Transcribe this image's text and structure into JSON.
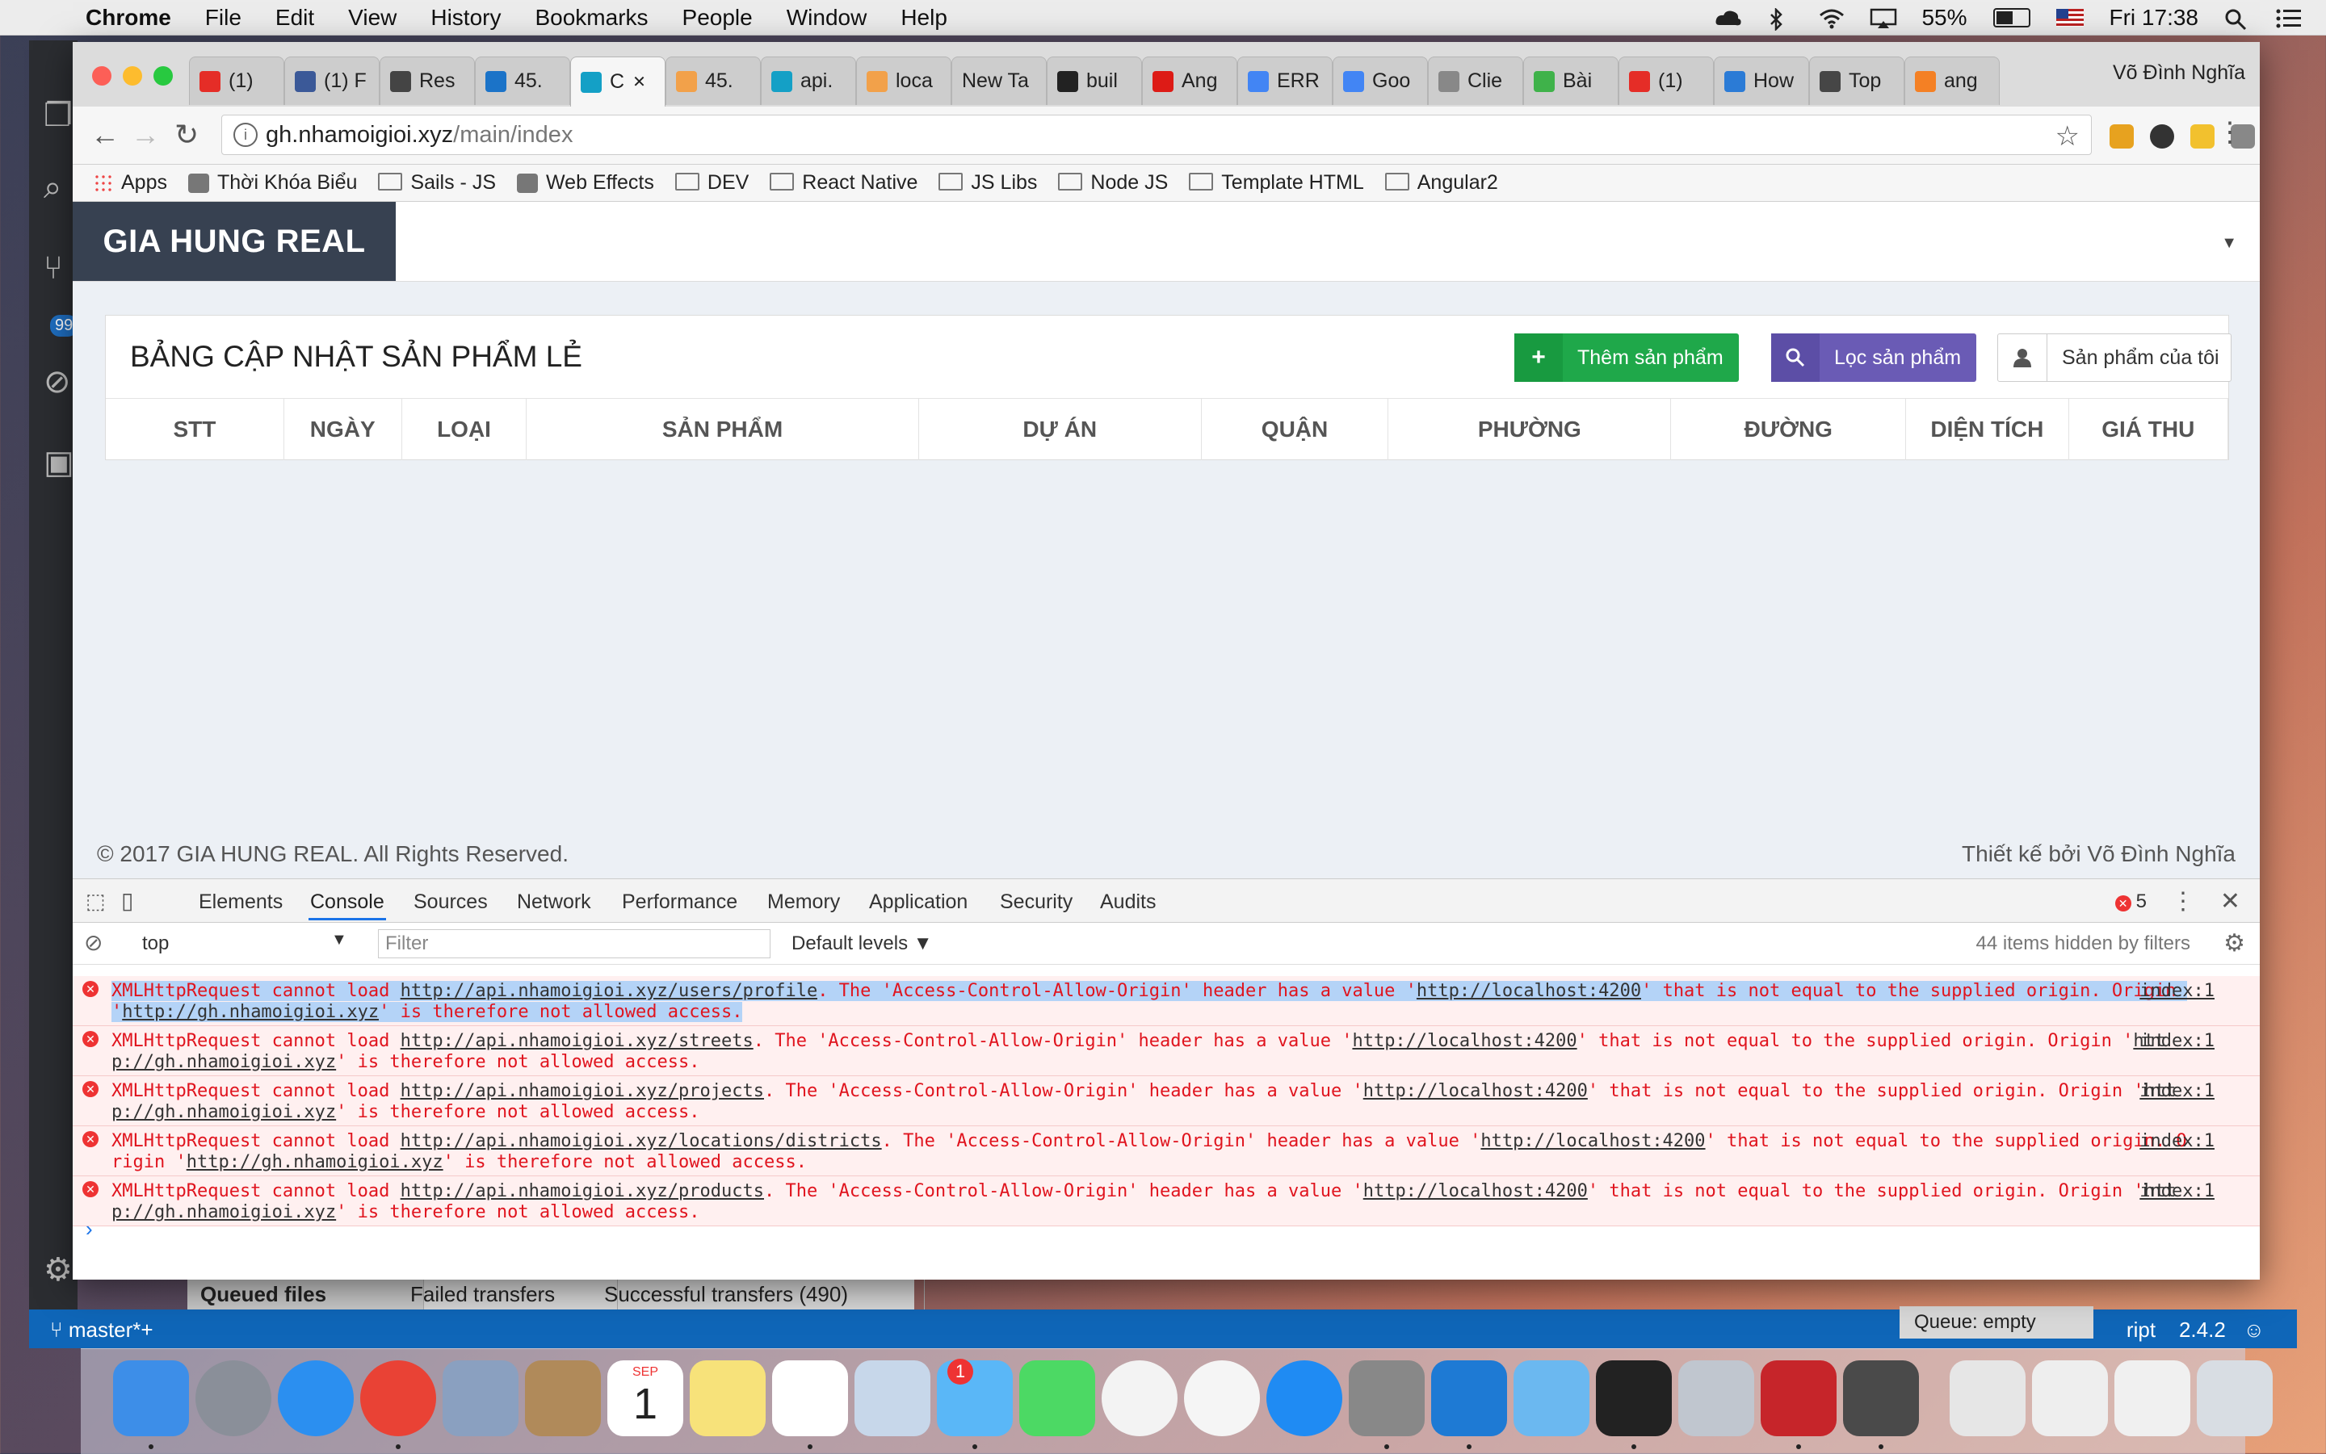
{
  "menubar": {
    "app": "Chrome",
    "items": [
      "File",
      "Edit",
      "View",
      "History",
      "Bookmarks",
      "People",
      "Window",
      "Help"
    ],
    "battery": "55%",
    "clock": "Fri 17:38"
  },
  "browser": {
    "profile_name": "Võ Đình Nghĩa",
    "tabs": [
      {
        "label": "(1)",
        "icon": "youtube-icon",
        "color": "#e52d27"
      },
      {
        "label": "(1) F",
        "icon": "facebook-icon",
        "color": "#3b5998"
      },
      {
        "label": "Res",
        "icon": "resource-icon",
        "color": "#444444"
      },
      {
        "label": "45.",
        "icon": "globe-icon",
        "color": "#1b73c8"
      },
      {
        "label": "C",
        "icon": "sails-icon",
        "color": "#14a0c6",
        "active": true
      },
      {
        "label": "45.",
        "icon": "phpmyadmin-icon",
        "color": "#f2a14a"
      },
      {
        "label": "api.",
        "icon": "sails-icon",
        "color": "#14a0c6"
      },
      {
        "label": "loca",
        "icon": "phpmyadmin-icon",
        "color": "#f2a14a"
      },
      {
        "label": "New Ta",
        "icon": "",
        "color": ""
      },
      {
        "label": "buil",
        "icon": "github-icon",
        "color": "#222222"
      },
      {
        "label": "Ang",
        "icon": "angular-icon",
        "color": "#dd1b16"
      },
      {
        "label": "ERR",
        "icon": "google-icon",
        "color": "#4285f4"
      },
      {
        "label": "Goo",
        "icon": "google-translate-icon",
        "color": "#4285f4"
      },
      {
        "label": "Clie",
        "icon": "document-icon",
        "color": "#888888"
      },
      {
        "label": "Bài",
        "icon": "site-icon",
        "color": "#3fb24a"
      },
      {
        "label": "(1)",
        "icon": "youtube-icon",
        "color": "#e52d27"
      },
      {
        "label": "How",
        "icon": "code-icon",
        "color": "#2b7bd6"
      },
      {
        "label": "Top",
        "icon": "wordpress-icon",
        "color": "#464646"
      },
      {
        "label": "ang",
        "icon": "stackoverflow-icon",
        "color": "#f48024"
      }
    ],
    "url_host": "gh.nhamoigioi.xyz",
    "url_path": "/main/index",
    "bookmarks": [
      {
        "label": "Apps",
        "type": "apps"
      },
      {
        "label": "Thời Khóa Biểu",
        "type": "site"
      },
      {
        "label": "Sails - JS",
        "type": "folder"
      },
      {
        "label": "Web Effects",
        "type": "site"
      },
      {
        "label": "DEV",
        "type": "folder"
      },
      {
        "label": "React Native",
        "type": "folder"
      },
      {
        "label": "JS Libs",
        "type": "folder"
      },
      {
        "label": "Node JS",
        "type": "folder"
      },
      {
        "label": "Template HTML",
        "type": "folder"
      },
      {
        "label": "Angular2",
        "type": "folder"
      }
    ]
  },
  "page": {
    "brand": "GIA HUNG REAL",
    "box_title": "BẢNG CẬP NHẬT SẢN PHẨM LẺ",
    "btn_add": "Thêm sản phẩm",
    "btn_filter": "Lọc sản phẩm",
    "btn_mine": "Sản phẩm của tôi",
    "columns": [
      "STT",
      "NGÀY",
      "LOẠI",
      "SẢN PHẨM",
      "DỰ ÁN",
      "QUẬN",
      "PHƯỜNG",
      "ĐƯỜNG",
      "DIỆN TÍCH",
      "GIÁ THU"
    ],
    "footer_left": "© 2017 GIA HUNG REAL. All Rights Reserved.",
    "footer_right": "Thiết kế bởi Võ Đình Nghĩa"
  },
  "devtools": {
    "tabs": [
      "Elements",
      "Console",
      "Sources",
      "Network",
      "Performance",
      "Memory",
      "Application",
      "Security",
      "Audits"
    ],
    "active_tab": "Console",
    "error_count": "5",
    "context": "top",
    "filter_placeholder": "Filter",
    "levels": "Default levels",
    "hidden_note": "44 items hidden by filters",
    "messages": [
      {
        "pre": "XMLHttpRequest cannot load ",
        "url": "http://api.nhamoigioi.xyz/users/profile",
        "mid": ". The 'Access-Control-Allow-Origin' header has a value '",
        "val": "http://localhost:4200",
        "post": "' that is not equal to the supplied origin. Origin '",
        "origin": "http://gh.nhamoigioi.xyz",
        "end": "' is therefore not allowed access.",
        "source": "index:1",
        "selected": true
      },
      {
        "pre": "XMLHttpRequest cannot load ",
        "url": "http://api.nhamoigioi.xyz/streets",
        "mid": ". The 'Access-Control-Allow-Origin' header has a value '",
        "val": "http://localhost:4200",
        "post": "' that is not equal to the supplied origin. Origin '",
        "origin": "http://gh.nhamoigioi.xyz",
        "end": "' is therefore not allowed access.",
        "source": "index:1"
      },
      {
        "pre": "XMLHttpRequest cannot load ",
        "url": "http://api.nhamoigioi.xyz/projects",
        "mid": ". The 'Access-Control-Allow-Origin' header has a value '",
        "val": "http://localhost:4200",
        "post": "' that is not equal to the supplied origin. Origin '",
        "origin": "http://gh.nhamoigioi.xyz",
        "end": "' is therefore not allowed access.",
        "source": "index:1"
      },
      {
        "pre": "XMLHttpRequest cannot load ",
        "url": "http://api.nhamoigioi.xyz/locations/districts",
        "mid": ". The 'Access-Control-Allow-Origin' header has a value '",
        "val": "http://localhost:4200",
        "post": "' that is not equal to the supplied origin. Origin '",
        "origin": "http://gh.nhamoigioi.xyz",
        "end": "' is therefore not allowed access.",
        "source": "index:1"
      },
      {
        "pre": "XMLHttpRequest cannot load ",
        "url": "http://api.nhamoigioi.xyz/products",
        "mid": ". The 'Access-Control-Allow-Origin' header has a value '",
        "val": "http://localhost:4200",
        "post": "' that is not equal to the supplied origin. Origin '",
        "origin": "http://gh.nhamoigioi.xyz",
        "end": "' is therefore not allowed access.",
        "source": "index:1"
      }
    ]
  },
  "background_apps": {
    "editor_badge": "99",
    "ftp_tabs": [
      "Queued files",
      "Failed transfers",
      "Successful transfers (490)"
    ],
    "branch": "master*+",
    "queue": "Queue: empty",
    "lang_partial": "ript",
    "version": "2.4.2"
  },
  "dock": {
    "messages_badge": "1",
    "calendar_month": "SEP",
    "calendar_day": "1",
    "apps": [
      {
        "name": "finder-icon",
        "color": "#3d8ee8"
      },
      {
        "name": "launchpad-icon",
        "color": "#8a8f99"
      },
      {
        "name": "safari-icon",
        "color": "#2b8ff0"
      },
      {
        "name": "chrome-icon",
        "color": "#e94235"
      },
      {
        "name": "stamp-icon",
        "color": "#8aa0c0"
      },
      {
        "name": "contacts-icon",
        "color": "#b08a5a"
      },
      {
        "name": "calendar-icon",
        "color": "#ffffff"
      },
      {
        "name": "notes-icon",
        "color": "#f7e27a"
      },
      {
        "name": "reminders-icon",
        "color": "#ffffff"
      },
      {
        "name": "preview-icon",
        "color": "#c7d7ea"
      },
      {
        "name": "messages-icon",
        "color": "#5ab7f7"
      },
      {
        "name": "facetime-icon",
        "color": "#4cd964"
      },
      {
        "name": "itunes-icon",
        "color": "#f3f3f3"
      },
      {
        "name": "photos-icon",
        "color": "#f5f5f5"
      },
      {
        "name": "app-store-icon",
        "color": "#1f8bf3"
      },
      {
        "name": "system-preferences-icon",
        "color": "#888888"
      },
      {
        "name": "vscode-icon",
        "color": "#1e7ad4"
      },
      {
        "name": "folder-icon",
        "color": "#6bb8f0"
      },
      {
        "name": "terminal-icon",
        "color": "#222222"
      },
      {
        "name": "settings-icon",
        "color": "#c0c6cf"
      },
      {
        "name": "filezilla-icon",
        "color": "#c6252a"
      },
      {
        "name": "sublime-icon",
        "color": "#4a4a4a"
      },
      {
        "name": "sql-icon",
        "color": "#e6e6e6"
      },
      {
        "name": "screenshot-icon",
        "color": "#eeeeee"
      },
      {
        "name": "document-stack-icon",
        "color": "#f0f0f0"
      },
      {
        "name": "trash-icon",
        "color": "#d8dde3"
      }
    ]
  }
}
